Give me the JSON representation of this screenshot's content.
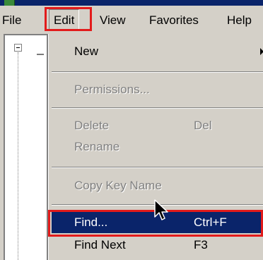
{
  "menubar": {
    "items": [
      "File",
      "Edit",
      "View",
      "Favorites",
      "Help"
    ]
  },
  "edit_menu": {
    "new": {
      "label": "New"
    },
    "permissions": {
      "label": "Permissions..."
    },
    "delete": {
      "label": "Delete",
      "shortcut": "Del"
    },
    "rename": {
      "label": "Rename"
    },
    "copy_key_name": {
      "label": "Copy Key Name"
    },
    "find": {
      "label": "Find...",
      "shortcut": "Ctrl+F"
    },
    "find_next": {
      "label": "Find Next",
      "shortcut": "F3"
    }
  },
  "colors": {
    "selection": "#0a246a",
    "highlight_box": "#e21b1b",
    "menu_background": "#d4d0c8"
  },
  "icons": [
    "tree-collapse-icon",
    "submenu-arrow-icon",
    "mouse-cursor-icon"
  ]
}
